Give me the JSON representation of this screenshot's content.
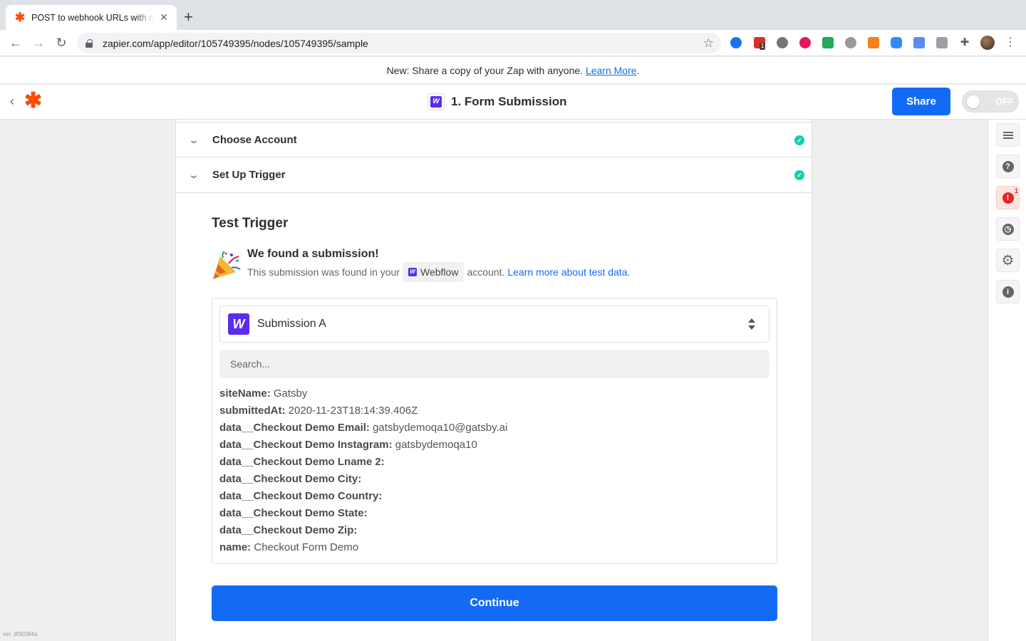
{
  "browser": {
    "tab_title": "POST to webhook URLs with new Webflow form submissions",
    "url": "zapier.com/app/editor/105749395/nodes/105749395/sample",
    "ext_badge": "1"
  },
  "banner": {
    "text": "New: Share a copy of your Zap with anyone. ",
    "link": "Learn More",
    "trail": "."
  },
  "header": {
    "step_title": "1. Form Submission",
    "share_label": "Share",
    "toggle_label": "OFF"
  },
  "sections": [
    {
      "label": "Choose Account",
      "status": "complete"
    },
    {
      "label": "Set Up Trigger",
      "status": "complete"
    }
  ],
  "test": {
    "title": "Test Trigger",
    "found_title": "We found a submission!",
    "found_prefix": "This submission was found in your",
    "app_name": "Webflow",
    "found_suffix": "account.",
    "learn_link": "Learn more about test data."
  },
  "sample": {
    "selected": "Submission A",
    "search_placeholder": "Search...",
    "fields": [
      {
        "key": "siteName:",
        "value": "Gatsby"
      },
      {
        "key": "submittedAt:",
        "value": "2020-11-23T18:14:39.406Z"
      },
      {
        "key": "data__Checkout Demo Email:",
        "value": "gatsbydemoqa10@gatsby.ai"
      },
      {
        "key": "data__Checkout Demo Instagram:",
        "value": "gatsbydemoqa10"
      },
      {
        "key": "data__Checkout Demo Lname 2:",
        "value": ""
      },
      {
        "key": "data__Checkout Demo City:",
        "value": ""
      },
      {
        "key": "data__Checkout Demo Country:",
        "value": ""
      },
      {
        "key": "data__Checkout Demo State:",
        "value": ""
      },
      {
        "key": "data__Checkout Demo Zip:",
        "value": ""
      },
      {
        "key": "name:",
        "value": "Checkout Form Demo"
      }
    ]
  },
  "continue_label": "Continue",
  "sidebar": {
    "alert_count": "1",
    "icons": [
      "details-icon",
      "help-icon",
      "alert-icon",
      "history-icon",
      "settings-icon",
      "info-icon"
    ]
  },
  "version": "ver. df30384a",
  "colors": {
    "brand": "#ff4a00",
    "primary": "#136bf5",
    "webflow": "#5a2cf0",
    "success": "#13d0ab",
    "alert": "#e8232a"
  }
}
